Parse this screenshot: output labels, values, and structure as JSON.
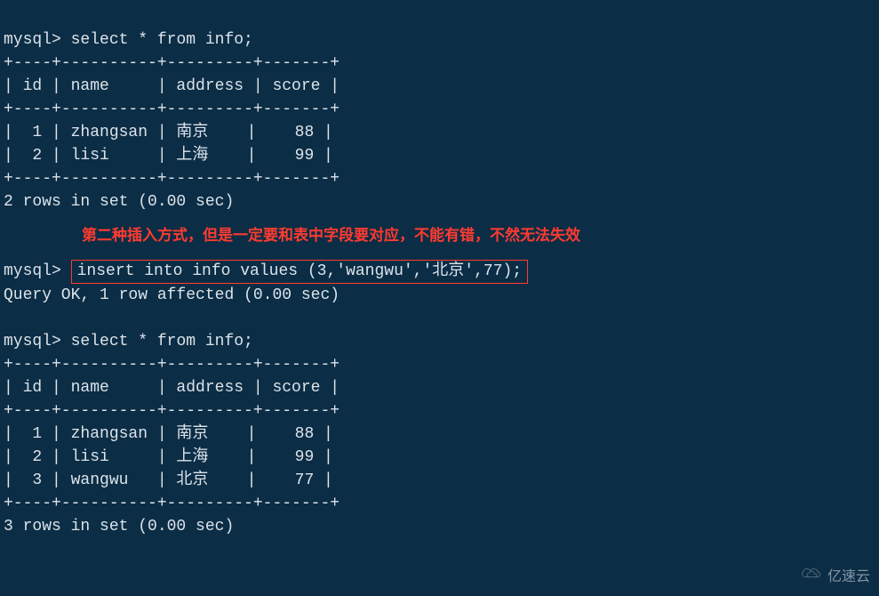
{
  "prompt": "mysql>",
  "queries": {
    "select1": "select * from info;",
    "insert": "insert into info values (3,'wangwu','北京',77);",
    "select2": "select * from info;"
  },
  "separator": "+----+----------+---------+-------+",
  "header": "| id | name     | address | score |",
  "table1": {
    "rows": [
      "|  1 | zhangsan | 南京    |    88 |",
      "|  2 | lisi     | 上海    |    99 |"
    ],
    "summary": "2 rows in set (0.00 sec)"
  },
  "insert_result": "Query OK, 1 row affected (0.00 sec)",
  "table2": {
    "rows": [
      "|  1 | zhangsan | 南京    |    88 |",
      "|  2 | lisi     | 上海    |    99 |",
      "|  3 | wangwu   | 北京    |    77 |"
    ],
    "summary": "3 rows in set (0.00 sec)"
  },
  "annotation": "第二种插入方式，但是一定要和表中字段要对应，不能有错，不然无法失效",
  "watermark": "亿速云"
}
